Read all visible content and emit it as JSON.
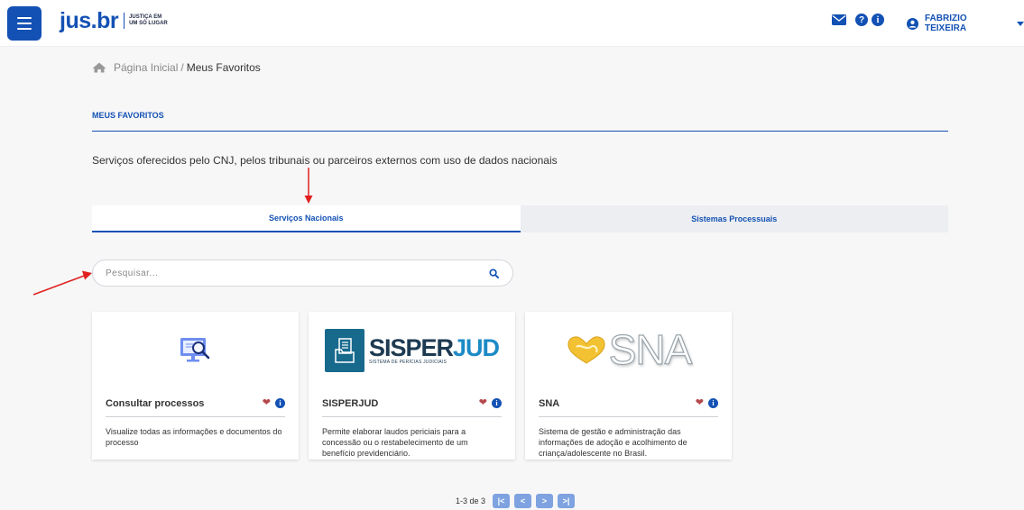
{
  "header": {
    "logo_text": "jus.br",
    "logo_tagline_1": "JUSTIÇA EM",
    "logo_tagline_2": "UM SÓ LUGAR",
    "help_icon_glyph": "?",
    "info_icon_glyph": "i",
    "user_name": "FABRIZIO TEIXEIRA"
  },
  "breadcrumb": {
    "home": "Página Inicial",
    "separator": "/",
    "current": "Meus Favoritos"
  },
  "page": {
    "title": "MEUS FAVORITOS",
    "description": "Serviços oferecidos pelo CNJ, pelos tribunais ou parceiros externos com uso de dados nacionais"
  },
  "tabs": [
    {
      "label": "Serviços Nacionais",
      "active": true
    },
    {
      "label": "Sistemas Processuais",
      "active": false
    }
  ],
  "search": {
    "placeholder": "Pesquisar..."
  },
  "cards": [
    {
      "title": "Consultar processos",
      "description": "Visualize todas as informações e documentos do processo",
      "image_icon": "monitor-search-icon"
    },
    {
      "title": "SISPERJUD",
      "description": "Permite elaborar laudos periciais para a concessão ou o restabelecimento de um benefício previdenciário.",
      "logo_word_1": "SISPER",
      "logo_word_2": "JUD",
      "logo_sub": "SISTEMA DE PERÍCIAS JUDICIAIS"
    },
    {
      "title": "SNA",
      "description": "Sistema de gestão e administração das informações de adoção e acolhimento de criança/adolescente no Brasil.",
      "logo_word": "SNA"
    }
  ],
  "pagination": {
    "summary": "1-3 de 3",
    "first": "|<",
    "prev": "<",
    "next": ">",
    "last": ">|"
  },
  "colors": {
    "primary": "#1351b4",
    "heart": "#b4484b",
    "annotation_arrow": "#e02020"
  }
}
